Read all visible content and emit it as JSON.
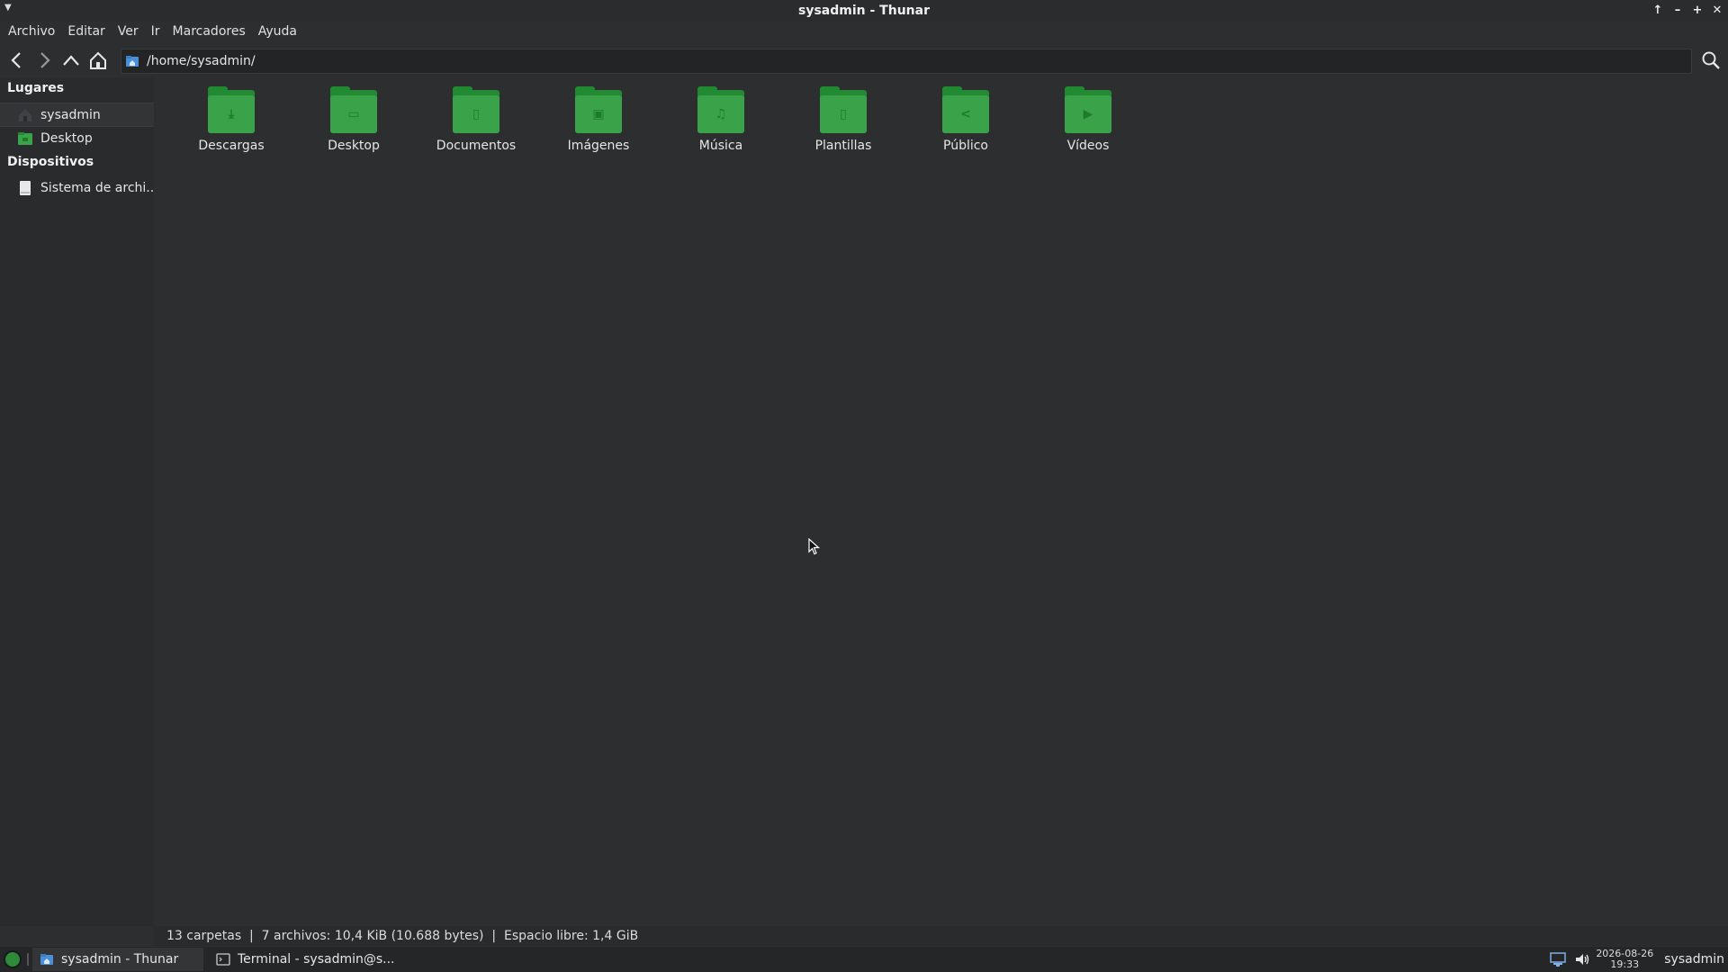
{
  "window": {
    "title": "sysadmin - Thunar",
    "controls": [
      "arrow-up-icon",
      "minimize-icon",
      "maximize-icon",
      "close-icon"
    ]
  },
  "menubar": {
    "items": [
      "Archivo",
      "Editar",
      "Ver",
      "Ir",
      "Marcadores",
      "Ayuda"
    ]
  },
  "toolbar": {
    "location": "/home/sysadmin/"
  },
  "sidebar": {
    "places_header": "Lugares",
    "places": [
      {
        "label": "sysadmin",
        "icon": "home-icon",
        "selected": true
      },
      {
        "label": "Desktop",
        "icon": "desktop-folder-icon",
        "selected": false
      }
    ],
    "devices_header": "Dispositivos",
    "devices": [
      {
        "label": "Sistema de archi...",
        "icon": "drive-icon"
      }
    ]
  },
  "files": [
    {
      "label": "Descargas",
      "glyph": "⤓"
    },
    {
      "label": "Desktop",
      "glyph": "▭"
    },
    {
      "label": "Documentos",
      "glyph": "▯"
    },
    {
      "label": "Imágenes",
      "glyph": "▣"
    },
    {
      "label": "Música",
      "glyph": "♫"
    },
    {
      "label": "Plantillas",
      "glyph": "▯"
    },
    {
      "label": "Público",
      "glyph": "<"
    },
    {
      "label": "Vídeos",
      "glyph": "▶"
    }
  ],
  "statusbar": {
    "text": "13 carpetas  |  7 archivos: 10,4 KiB (10.688 bytes)  |  Espacio libre: 1,4 GiB"
  },
  "taskbar": {
    "tasks": [
      {
        "label": "sysadmin - Thunar",
        "active": true
      },
      {
        "label": "Terminal - sysadmin@s...",
        "active": false
      }
    ],
    "clock_date": "2026-08-26",
    "clock_time": "19:33",
    "user": "sysadmin"
  },
  "colors": {
    "accent": "#3aa34a",
    "background": "#2d2e30"
  }
}
